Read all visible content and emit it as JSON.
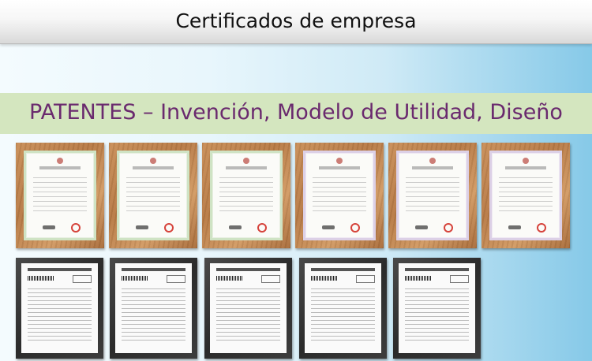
{
  "header": {
    "title": "Certificados de empresa"
  },
  "section": {
    "heading": "PATENTES – Invención, Modelo de Utilidad, Diseño"
  },
  "certificates": [
    {
      "paper_style": "green"
    },
    {
      "paper_style": "green"
    },
    {
      "paper_style": "green"
    },
    {
      "paper_style": "purple"
    },
    {
      "paper_style": "purple"
    },
    {
      "paper_style": "purple"
    }
  ],
  "documents_count": 5,
  "colors": {
    "heading": "#6a2a6e",
    "band": "#d4e6bf",
    "wood": "#c98e57",
    "dark_frame": "#2b2b2b"
  }
}
